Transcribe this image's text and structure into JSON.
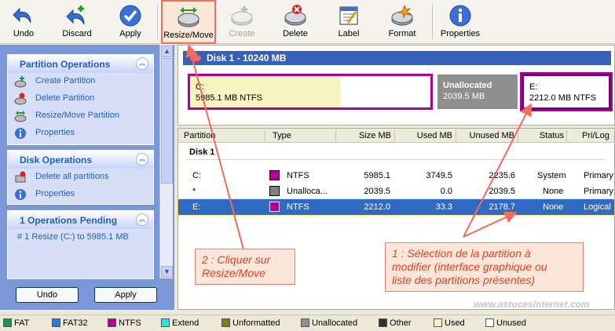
{
  "toolbar": {
    "undo": "Undo",
    "discard": "Discard",
    "apply": "Apply",
    "resize_move": "Resize/Move",
    "create": "Create",
    "delete": "Delete",
    "label": "Label",
    "format": "Format",
    "properties": "Properties"
  },
  "sidebar": {
    "partition_operations": {
      "title": "Partition Operations",
      "items": [
        "Create Partition",
        "Delete Partition",
        "Resize/Move Partition",
        "Properties"
      ]
    },
    "disk_operations": {
      "title": "Disk Operations",
      "items": [
        "Delete all partitions",
        "Properties"
      ]
    },
    "pending": {
      "title": "1 Operations Pending",
      "items": [
        "#  1  Resize (C:) to 5985.1 MB"
      ]
    },
    "undo_button": "Undo",
    "apply_button": "Apply"
  },
  "disk": {
    "title": "Disk 1 - 10240 MB",
    "partitions": [
      {
        "name": "C:",
        "size_text": "5985.1 MB  NTFS",
        "used_fraction": 0.626
      },
      {
        "name": "Unallocated",
        "size_text": "2039.5 MB"
      },
      {
        "name": "E:",
        "size_text": "2212.0 MB  NTFS"
      }
    ]
  },
  "table": {
    "headers": [
      "Partition",
      "Type",
      "Size MB",
      "Used MB",
      "Unused MB",
      "Status",
      "Pri/Log"
    ],
    "group": "Disk 1",
    "rows": [
      {
        "partition": "C:",
        "type": "NTFS",
        "size": "5985.1",
        "used": "3749.5",
        "unused": "2235.6",
        "status": "System",
        "prilog": "Primary",
        "color": "#b0009a"
      },
      {
        "partition": "*",
        "type": "Unalloca...",
        "size": "2039.5",
        "used": "0.0",
        "unused": "2039.5",
        "status": "None",
        "prilog": "Primary",
        "color": "#808080"
      },
      {
        "partition": "E:",
        "type": "NTFS",
        "size": "2212.0",
        "used": "33.3",
        "unused": "2178.7",
        "status": "None",
        "prilog": "Logical",
        "color": "#b0009a"
      }
    ]
  },
  "annotations": {
    "note2": "2 : Cliquer sur\nResize/Move",
    "note1": "1 : Sélection de la partition à\nmodifier (interface graphique ou\nliste des partitions présentes)"
  },
  "watermark": "www.astucesinternet.com",
  "legend": [
    {
      "label": "FAT",
      "color": "#00a050"
    },
    {
      "label": "FAT32",
      "color": "#1e7fe0"
    },
    {
      "label": "NTFS",
      "color": "#b0009a"
    },
    {
      "label": "Extend",
      "color": "#30e0e0"
    },
    {
      "label": "Unformatted",
      "color": "#808000"
    },
    {
      "label": "Unallocated",
      "color": "#909090"
    },
    {
      "label": "Other",
      "color": "#303030"
    },
    {
      "label": "Used",
      "color": "#f8f4c0"
    },
    {
      "label": "Unused",
      "color": "#ffffff"
    }
  ]
}
